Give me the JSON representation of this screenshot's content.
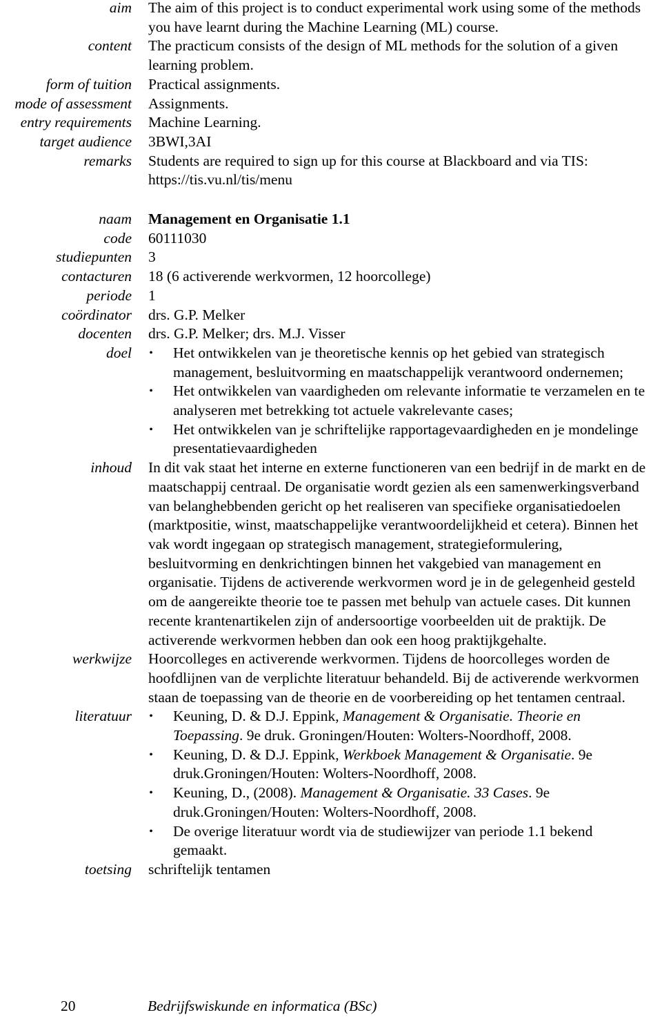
{
  "course1": {
    "rows": [
      {
        "label": "aim",
        "value": "The aim of this project is to conduct experimental work using some of the methods you have learnt during the Machine Learning (ML) course."
      },
      {
        "label": "content",
        "value": "The practicum consists of the design of ML methods for the solution of a given learning problem."
      },
      {
        "label": "form of tuition",
        "value": "Practical assignments."
      },
      {
        "label": "mode of assessment",
        "value": "Assignments."
      },
      {
        "label": "entry requirements",
        "value": "Machine Learning."
      },
      {
        "label": "target audience",
        "value": "3BWI,3AI"
      },
      {
        "label": "remarks",
        "value": "Students are required to sign up for this course at Blackboard and via TIS: https://tis.vu.nl/tis/menu"
      }
    ]
  },
  "course2": {
    "naam": {
      "label": "naam",
      "value": "Management en Organisatie 1.1"
    },
    "code": {
      "label": "code",
      "value": "60111030"
    },
    "studiepunten": {
      "label": "studiepunten",
      "value": "3"
    },
    "contacturen": {
      "label": "contacturen",
      "value": "18 (6 activerende werkvormen, 12 hoorcollege)"
    },
    "periode": {
      "label": "periode",
      "value": "1"
    },
    "coordinator": {
      "label": "coördinator",
      "value": "drs. G.P. Melker"
    },
    "docenten": {
      "label": "docenten",
      "value": "drs. G.P. Melker; drs. M.J. Visser"
    },
    "doel": {
      "label": "doel",
      "items": [
        "Het ontwikkelen van je theoretische kennis op het gebied van strategisch management, besluitvorming en maatschappelijk verantwoord ondernemen;",
        "Het ontwikkelen van vaardigheden om relevante informatie te verzamelen en te analyseren met betrekking tot actuele vakrelevante cases;",
        "Het ontwikkelen van je schriftelijke rapportagevaardigheden en je mondelinge presentatievaardigheden"
      ]
    },
    "inhoud": {
      "label": "inhoud",
      "value": "In dit vak staat het interne en externe functioneren van een bedrijf in de markt en de maatschappij centraal. De organisatie wordt gezien als een samenwerkingsverband van belanghebbenden gericht op het realiseren van specifieke organisatiedoelen (marktpositie, winst, maatschappelijke verantwoordelijkheid et cetera). Binnen het vak wordt ingegaan op strategisch management, strategieformulering, besluitvorming en denkrichtingen binnen het vakgebied van management en organisatie. Tijdens de activerende werkvormen word je in de gelegenheid gesteld om de aangereikte theorie toe te passen met behulp van actuele cases. Dit kunnen recente krantenartikelen zijn of andersoortige voorbeelden uit de praktijk. De activerende werkvormen hebben dan ook een hoog praktijkgehalte."
    },
    "werkwijze": {
      "label": "werkwijze",
      "value": "Hoorcolleges en activerende werkvormen. Tijdens de hoorcolleges worden de hoofdlijnen van de verplichte literatuur behandeld. Bij de activerende werkvormen staan de toepassing van de theorie en de voorbereiding op het tentamen centraal."
    },
    "literatuur": {
      "label": "literatuur",
      "items": [
        {
          "pre": "Keuning, D. & D.J. Eppink, ",
          "title": "Management & Organisatie. Theorie en Toepassing",
          "post": ". 9e druk. Groningen/Houten: Wolters-Noordhoff, 2008."
        },
        {
          "pre": "Keuning, D. & D.J. Eppink, ",
          "title": "Werkboek Management & Organisatie",
          "post": ". 9e druk.Groningen/Houten: Wolters-Noordhoff, 2008."
        },
        {
          "pre": "Keuning, D., (2008). ",
          "title": "Management & Organisatie. 33 Cases",
          "post": ". 9e druk.Groningen/Houten: Wolters-Noordhoff, 2008."
        },
        {
          "pre": "De overige literatuur wordt via de studiewijzer van periode 1.1 bekend gemaakt.",
          "title": "",
          "post": ""
        }
      ]
    },
    "toetsing": {
      "label": "toetsing",
      "value": "schriftelijk tentamen"
    }
  },
  "footer": {
    "page_number": "20",
    "title": "Bedrijfswiskunde en informatica (BSc)"
  },
  "bullet_glyph": "•"
}
